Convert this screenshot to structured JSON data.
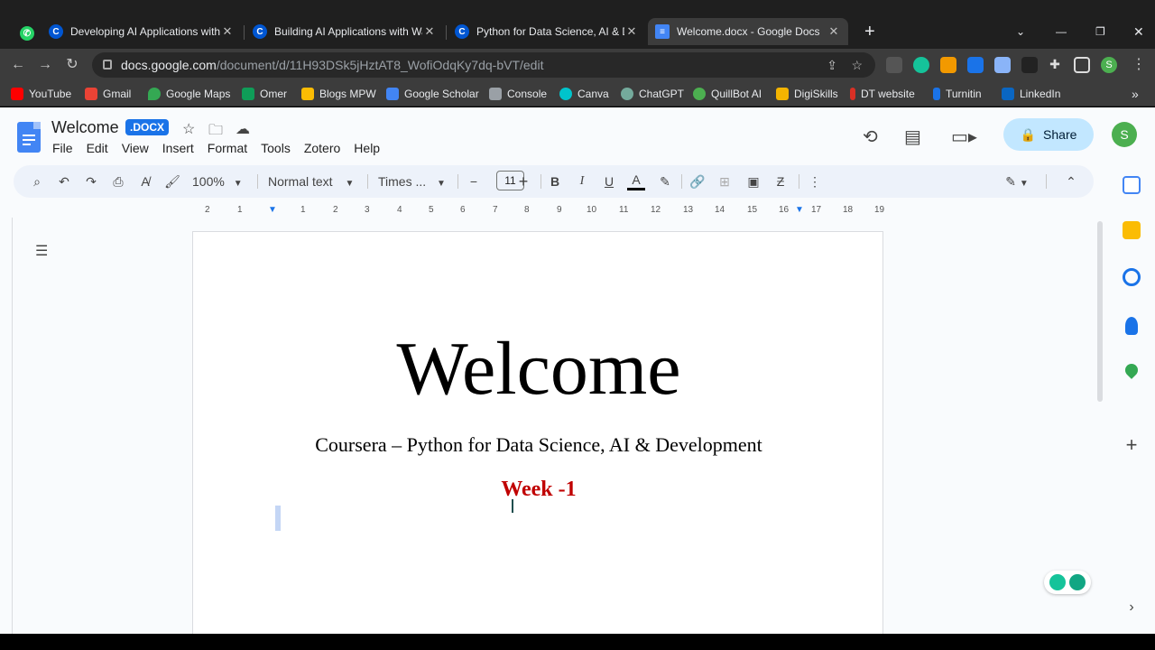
{
  "tabs": [
    {
      "title": "Developing AI Applications with",
      "favicon": "coursera-icon",
      "color": "#0056d2",
      "close": "✕"
    },
    {
      "title": "Building AI Applications with Wa",
      "favicon": "coursera-icon",
      "color": "#0056d2",
      "close": "✕"
    },
    {
      "title": "Python for Data Science, AI & De",
      "favicon": "coursera-icon",
      "color": "#0056d2",
      "close": "✕"
    },
    {
      "title": "Welcome.docx - Google Docs",
      "favicon": "docs-icon",
      "color": "#4285f4",
      "close": "✕"
    }
  ],
  "address": {
    "host": "docs.google.com",
    "path": "/document/d/11H93DSk5jHztAT8_WofiOdqKy7dq-bVT/edit"
  },
  "bookmarks": [
    {
      "label": "YouTube",
      "color": "#ff0000"
    },
    {
      "label": "Gmail",
      "color": "#ea4335"
    },
    {
      "label": "Google Maps",
      "color": "#34a853"
    },
    {
      "label": "Omer",
      "color": "#0f9d58"
    },
    {
      "label": "Blogs MPW",
      "color": "#fbbc04"
    },
    {
      "label": "Google Scholar",
      "color": "#4285f4"
    },
    {
      "label": "Console",
      "color": "#9aa0a6"
    },
    {
      "label": "Canva",
      "color": "#00c4cc"
    },
    {
      "label": "ChatGPT",
      "color": "#74aa9c"
    },
    {
      "label": "QuillBot AI",
      "color": "#4caf50"
    },
    {
      "label": "DigiSkills",
      "color": "#f4b400"
    },
    {
      "label": "DT website",
      "color": "#d93025"
    },
    {
      "label": "Turnitin",
      "color": "#1a73e8"
    },
    {
      "label": "LinkedIn",
      "color": "#0a66c2"
    }
  ],
  "doc": {
    "title": "Welcome",
    "badge": ".DOCX",
    "menu": [
      "File",
      "Edit",
      "View",
      "Insert",
      "Format",
      "Tools",
      "Zotero",
      "Help"
    ],
    "share_label": "Share",
    "avatar_letter": "S"
  },
  "format_toolbar": {
    "zoom": "100%",
    "style": "Normal text",
    "font": "Times ...",
    "font_size": "11"
  },
  "ruler_ticks": [
    "2",
    "1",
    "1",
    "2",
    "3",
    "4",
    "5",
    "6",
    "7",
    "8",
    "9",
    "10",
    "11",
    "12",
    "13",
    "14",
    "15",
    "16",
    "17",
    "18",
    "19"
  ],
  "page": {
    "heading": "Welcome",
    "subtitle": "Coursera – Python for Data Science, AI & Development",
    "week": "Week -1"
  },
  "colors": {
    "week": "#c00000",
    "accent": "#1a73e8",
    "share_bg": "#c2e7ff"
  }
}
